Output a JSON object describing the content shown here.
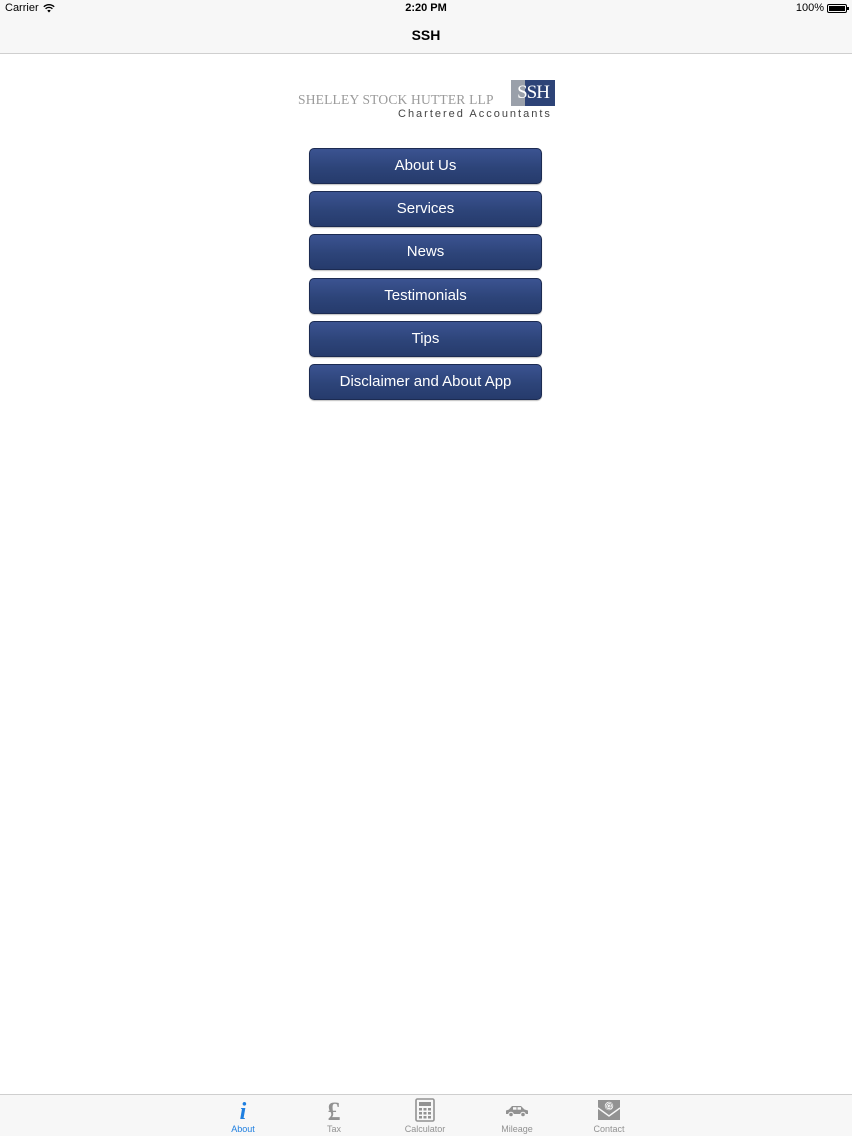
{
  "status_bar": {
    "carrier": "Carrier",
    "time": "2:20 PM",
    "battery": "100%"
  },
  "nav": {
    "title": "SSH"
  },
  "logo": {
    "company_name": "SHELLEY STOCK HUTTER LLP",
    "badge": "SSH",
    "tagline": "Chartered Accountants"
  },
  "menu": {
    "items": [
      {
        "label": "About Us"
      },
      {
        "label": "Services"
      },
      {
        "label": "News"
      },
      {
        "label": "Testimonials"
      },
      {
        "label": "Tips"
      },
      {
        "label": "Disclaimer and About App"
      }
    ]
  },
  "tab_bar": {
    "active_color": "#1f7fe0",
    "inactive_color": "#929292",
    "tabs": [
      {
        "label": "About",
        "icon": "info-icon",
        "active": true
      },
      {
        "label": "Tax",
        "icon": "pound-icon",
        "active": false
      },
      {
        "label": "Calculator",
        "icon": "calculator-icon",
        "active": false
      },
      {
        "label": "Mileage",
        "icon": "car-icon",
        "active": false
      },
      {
        "label": "Contact",
        "icon": "envelope-at-icon",
        "active": false
      }
    ]
  },
  "colors": {
    "button_fill": "#2d4479",
    "button_text": "#ffffff",
    "bar_background": "#f7f7f7"
  }
}
